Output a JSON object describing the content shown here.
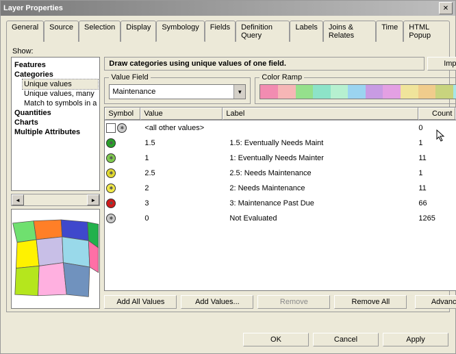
{
  "window": {
    "title": "Layer Properties"
  },
  "tabs": [
    "General",
    "Source",
    "Selection",
    "Display",
    "Symbology",
    "Fields",
    "Definition Query",
    "Labels",
    "Joins & Relates",
    "Time",
    "HTML Popup"
  ],
  "active_tab": "Symbology",
  "show_label": "Show:",
  "tree": {
    "features": "Features",
    "categories": "Categories",
    "cat_items": [
      "Unique values",
      "Unique values, many",
      "Match to symbols in a"
    ],
    "selected": "Unique values",
    "quantities": "Quantities",
    "charts": "Charts",
    "multiple": "Multiple Attributes"
  },
  "instruction": "Draw categories using unique values of one field.",
  "import_btn": "Import...",
  "value_field": {
    "legend": "Value Field",
    "value": "Maintenance"
  },
  "color_ramp": {
    "legend": "Color Ramp",
    "stops": [
      "#f28cb1",
      "#f6b6b6",
      "#95e08c",
      "#8de3c8",
      "#b6f0d0",
      "#9bd4f0",
      "#c89be3",
      "#e3a0e3",
      "#f0e49b",
      "#f0cc8c",
      "#c8d47e",
      "#a6e6e6"
    ]
  },
  "grid": {
    "headers": {
      "symbol": "Symbol",
      "value": "Value",
      "label": "Label",
      "count": "Count"
    },
    "all_other": {
      "value": "<all other values>",
      "label": "",
      "count": "0",
      "color": "#cccccc"
    },
    "rows": [
      {
        "value": "1.5",
        "label": "1.5: Eventually Needs Maint",
        "count": "1",
        "color": "#2aa02a"
      },
      {
        "value": "1",
        "label": "1: Eventually Needs Mainter",
        "count": "11",
        "color": "#7fc94f"
      },
      {
        "value": "2.5",
        "label": "2.5: Needs Maintenance",
        "count": "1",
        "color": "#e0d830"
      },
      {
        "value": "2",
        "label": "2: Needs Maintenance",
        "count": "11",
        "color": "#f0e84a"
      },
      {
        "value": "3",
        "label": "3: Maintenance Past Due",
        "count": "66",
        "color": "#d11a1a"
      },
      {
        "value": "0",
        "label": "Not Evaluated",
        "count": "1265",
        "color": "#c8c8c8"
      }
    ]
  },
  "buttons": {
    "add_all": "Add All Values",
    "add": "Add Values...",
    "remove": "Remove",
    "remove_all": "Remove All",
    "advanced": "Advanced"
  },
  "footer": {
    "ok": "OK",
    "cancel": "Cancel",
    "apply": "Apply"
  }
}
